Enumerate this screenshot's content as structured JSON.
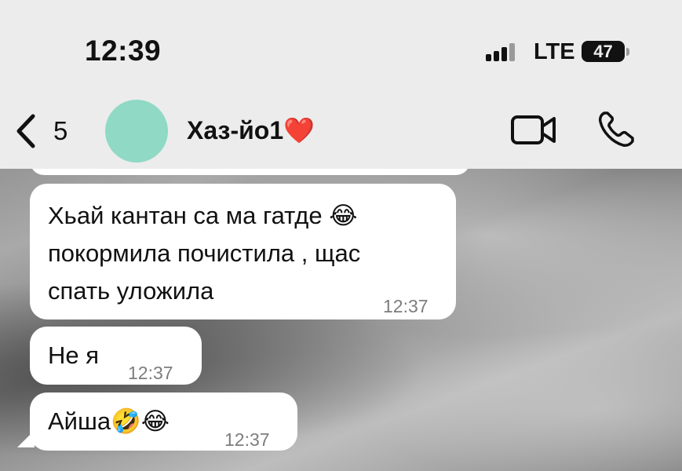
{
  "status_bar": {
    "time": "12:39",
    "network": "LTE",
    "battery": "47"
  },
  "chat_header": {
    "back_count": "5",
    "contact_name": "Хаз-йо1❤️",
    "avatar_color": "#8fd9c5",
    "icons": [
      "chevron-left-icon",
      "video-camera-icon",
      "phone-icon"
    ]
  },
  "messages": [
    {
      "text": "Хьай кантан са ма гатде 😂\nпокормила почистила , щас\nспать уложила",
      "time": "12:37"
    },
    {
      "text": "Не я",
      "time": "12:37"
    },
    {
      "text": "Айша🤣😂",
      "time": "12:37"
    }
  ],
  "colors": {
    "header_bg": "#ececec",
    "bubble_bg": "#ffffff",
    "timestamp": "#7d7d7d"
  }
}
